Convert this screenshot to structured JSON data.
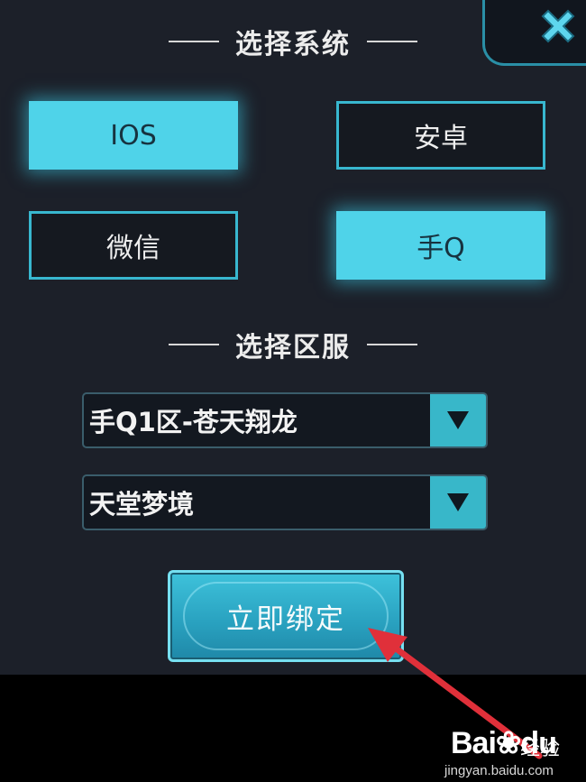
{
  "dialog": {
    "close_icon": "close-x-icon",
    "system_section_title": "选择系统",
    "systems": [
      {
        "label": "IOS",
        "selected": true
      },
      {
        "label": "安卓",
        "selected": false
      },
      {
        "label": "微信",
        "selected": false
      },
      {
        "label": "手Q",
        "selected": true
      }
    ],
    "server_section_title": "选择区服",
    "server_select_value": "手Q1区-苍天翔龙",
    "realm_select_value": "天堂梦境",
    "dropdown_icon": "triangle-down-icon",
    "bind_button_label": "立即绑定"
  },
  "annotation": {
    "color": "#e0303a",
    "icon": "red-arrow-pointer"
  },
  "watermark": {
    "brand": "Bai",
    "brand_tail": "du",
    "product": "经验",
    "url": "jingyan.baidu.com"
  },
  "colors": {
    "panel_bg": "#1c2029",
    "accent": "#4fd3e9",
    "border": "#38b7cf"
  }
}
